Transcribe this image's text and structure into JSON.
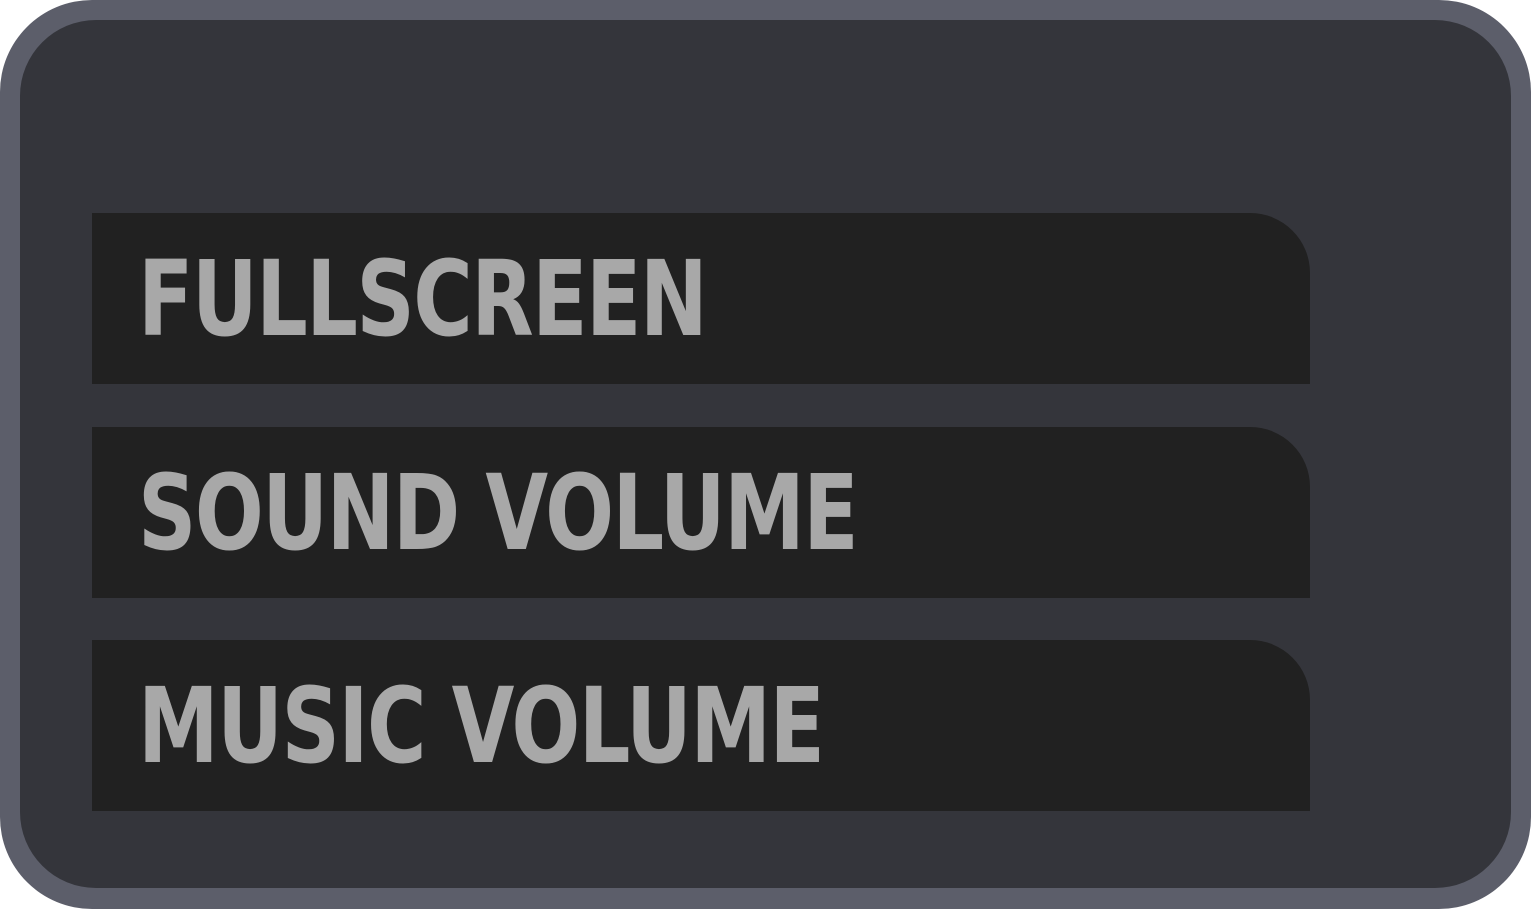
{
  "settings_menu": {
    "options": [
      {
        "label": "FULLSCREEN"
      },
      {
        "label": "SOUND VOLUME"
      },
      {
        "label": "MUSIC VOLUME"
      }
    ]
  },
  "colors": {
    "frame_border": "#5c5e6a",
    "panel_background": "#34353b",
    "row_background": "#212121",
    "label_text": "#a8a8a8"
  }
}
